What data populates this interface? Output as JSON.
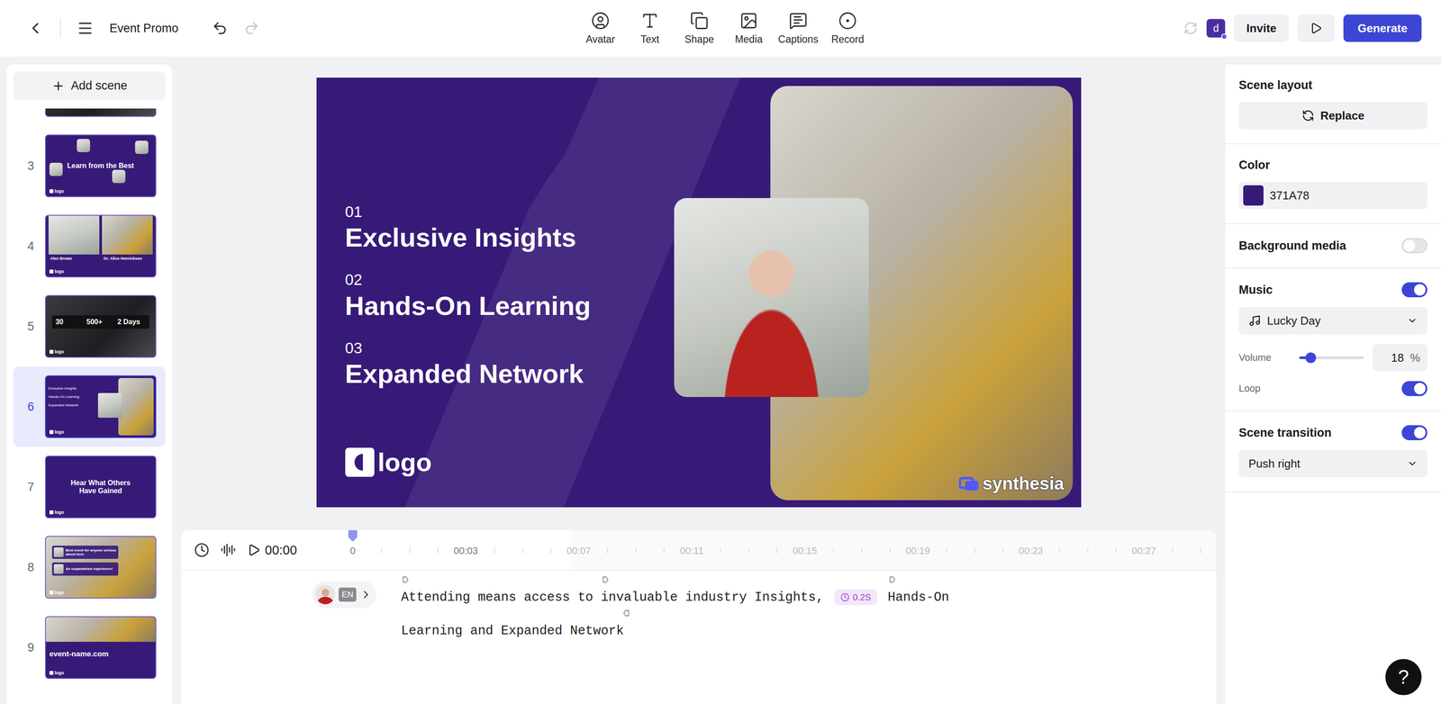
{
  "topbar": {
    "title": "Event Promo",
    "redo_disabled": true,
    "tools": [
      {
        "label": "Avatar"
      },
      {
        "label": "Text"
      },
      {
        "label": "Shape"
      },
      {
        "label": "Media"
      },
      {
        "label": "Captions"
      },
      {
        "label": "Record"
      }
    ],
    "user_initial": "d",
    "invite": "Invite",
    "generate": "Generate"
  },
  "scenes_panel": {
    "add_scene": "Add scene",
    "scenes": [
      {
        "kind": "partial",
        "selected": false
      },
      {
        "number": "3",
        "kind": "title-avatars",
        "title": "Learn from the Best",
        "logo": "logo",
        "selected": false
      },
      {
        "number": "4",
        "kind": "speakers",
        "people": [
          "Alex Brown",
          "Dr. Alice Henricksen"
        ],
        "logo": "logo",
        "selected": false
      },
      {
        "number": "5",
        "kind": "stats",
        "stats": [
          "30",
          "500+",
          "2 Days"
        ],
        "logo": "logo",
        "selected": false
      },
      {
        "number": "6",
        "kind": "list",
        "items": [
          "Exclusive Insights",
          "Hands-On Learning",
          "Expanded Network"
        ],
        "logo": "logo",
        "selected": true
      },
      {
        "number": "7",
        "kind": "title",
        "title": "Hear What Others Have Gained",
        "logo": "logo",
        "selected": false
      },
      {
        "number": "8",
        "kind": "testimonials",
        "quotes": [
          "Best event for anyone serious about tech.",
          "An unparalleled experience!"
        ],
        "logo": "logo",
        "selected": false
      },
      {
        "number": "9",
        "kind": "end",
        "title": "event-name.com",
        "logo": "logo",
        "selected": false
      }
    ]
  },
  "canvas": {
    "items": [
      {
        "number": "01",
        "label": "Exclusive Insights"
      },
      {
        "number": "02",
        "label": "Hands-On Learning"
      },
      {
        "number": "03",
        "label": "Expanded Network"
      }
    ],
    "logo": "logo",
    "watermark": "synthesia"
  },
  "timeline": {
    "time": "00:00",
    "playhead": 0,
    "scene_span": 0.26,
    "ticks": [
      {
        "label": "0",
        "active": true
      },
      {
        "label": "00:03",
        "active": true
      },
      {
        "label": "00:07",
        "active": false
      },
      {
        "label": "00:11",
        "active": false
      },
      {
        "label": "00:15",
        "active": false
      },
      {
        "label": "00:19",
        "active": false
      },
      {
        "label": "00:23",
        "active": false
      },
      {
        "label": "00:27",
        "active": false
      }
    ],
    "language": "EN",
    "script": [
      {
        "kind": "text",
        "text": "Attending means access to ",
        "marker": true,
        "end_marker": false
      },
      {
        "kind": "text",
        "text": "invaluable industry Insights,",
        "marker": true,
        "end_marker": false
      },
      {
        "kind": "pause",
        "text": "0.2S"
      },
      {
        "kind": "text",
        "text": "Hands-On Learning and Expanded Network",
        "marker": true,
        "end_marker": true
      }
    ]
  },
  "properties": {
    "scene_layout": {
      "title": "Scene layout",
      "button": "Replace"
    },
    "color": {
      "title": "Color",
      "value": "371A78",
      "color": "#371A78"
    },
    "background_media": {
      "title": "Background media",
      "on": false
    },
    "music": {
      "title": "Music",
      "on": true,
      "track": "Lucky Day",
      "volume_label": "Volume",
      "volume": "18",
      "unit": "%",
      "level": 0.18,
      "loop_label": "Loop",
      "loop": true
    },
    "transition": {
      "title": "Scene transition",
      "on": true,
      "value": "Push right"
    }
  },
  "help": "?"
}
